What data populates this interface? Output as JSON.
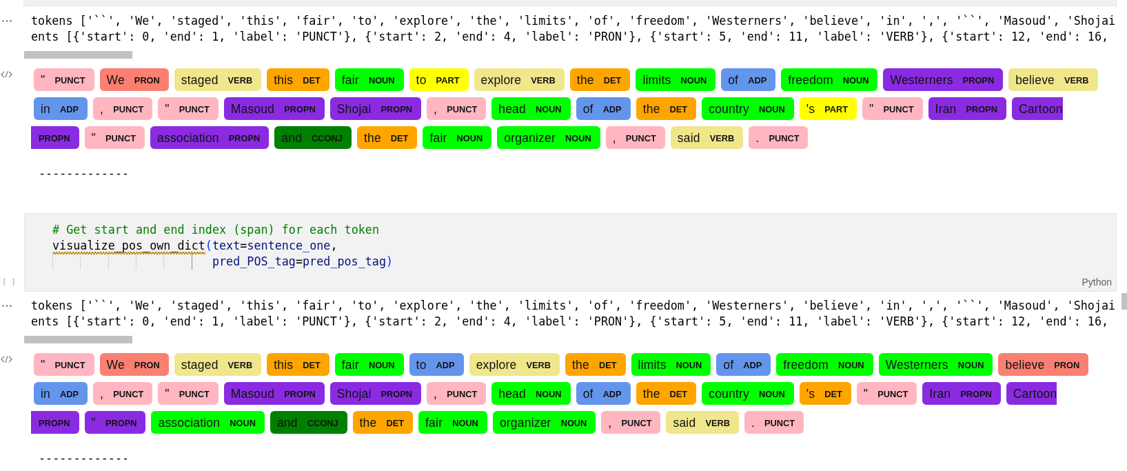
{
  "cells": [
    {
      "kind": "output",
      "text_lines": [
        "tokens ['``', 'We', 'staged', 'this', 'fair', 'to', 'explore', 'the', 'limits', 'of', 'freedom', 'Westerners', 'believe', 'in', ',', '``', 'Masoud', 'Shojai",
        "ents [{'start': 0, 'end': 1, 'label': 'PUNCT'}, {'start': 2, 'end': 4, 'label': 'PRON'}, {'start': 5, 'end': 11, 'label': 'VERB'}, {'start': 12, 'end': 16,"
      ],
      "entity_rows": [
        [
          {
            "kind": "whole",
            "text": "\"",
            "label": "PUNCT",
            "color": "#ffb6c1"
          },
          {
            "kind": "whole",
            "text": "We",
            "label": "PRON",
            "color": "#fa8072"
          },
          {
            "kind": "whole",
            "text": "staged",
            "label": "VERB",
            "color": "#f0e68c"
          },
          {
            "kind": "whole",
            "text": "this",
            "label": "DET",
            "color": "#ffa500"
          },
          {
            "kind": "whole",
            "text": "fair",
            "label": "NOUN",
            "color": "#00ff00"
          },
          {
            "kind": "whole",
            "text": "to",
            "label": "PART",
            "color": "#ffff00"
          },
          {
            "kind": "whole",
            "text": "explore",
            "label": "VERB",
            "color": "#f0e68c"
          },
          {
            "kind": "whole",
            "text": "the",
            "label": "DET",
            "color": "#ffa500"
          },
          {
            "kind": "whole",
            "text": "limits",
            "label": "NOUN",
            "color": "#00ff00"
          },
          {
            "kind": "whole",
            "text": "of",
            "label": "ADP",
            "color": "#6495ed"
          },
          {
            "kind": "whole",
            "text": "freedom",
            "label": "NOUN",
            "color": "#00ff00"
          },
          {
            "kind": "whole",
            "text": "Westerners",
            "label": "PROPN",
            "color": "#8a2be2"
          },
          {
            "kind": "whole",
            "text": "believe",
            "label": "VERB",
            "color": "#f0e68c"
          }
        ],
        [
          {
            "kind": "whole",
            "text": "in",
            "label": "ADP",
            "color": "#6495ed"
          },
          {
            "kind": "whole",
            "text": ",",
            "label": "PUNCT",
            "color": "#ffb6c1"
          },
          {
            "kind": "whole",
            "text": "\"",
            "label": "PUNCT",
            "color": "#ffb6c1"
          },
          {
            "kind": "whole",
            "text": "Masoud",
            "label": "PROPN",
            "color": "#8a2be2"
          },
          {
            "kind": "whole",
            "text": "Shojai",
            "label": "PROPN",
            "color": "#8a2be2"
          },
          {
            "kind": "whole",
            "text": ",",
            "label": "PUNCT",
            "color": "#ffb6c1"
          },
          {
            "kind": "whole",
            "text": "head",
            "label": "NOUN",
            "color": "#00ff00"
          },
          {
            "kind": "whole",
            "text": "of",
            "label": "ADP",
            "color": "#6495ed"
          },
          {
            "kind": "whole",
            "text": "the",
            "label": "DET",
            "color": "#ffa500"
          },
          {
            "kind": "whole",
            "text": "country",
            "label": "NOUN",
            "color": "#00ff00"
          },
          {
            "kind": "whole",
            "text": "'s",
            "label": "PART",
            "color": "#ffff00"
          },
          {
            "kind": "whole",
            "text": "\"",
            "label": "PUNCT",
            "color": "#ffb6c1"
          },
          {
            "kind": "whole",
            "text": "Iran",
            "label": "PROPN",
            "color": "#8a2be2"
          },
          {
            "kind": "head",
            "text": "Cartoon",
            "color": "#8a2be2"
          }
        ],
        [
          {
            "kind": "tail",
            "label": "PROPN",
            "color": "#8a2be2"
          },
          {
            "kind": "whole",
            "text": "\"",
            "label": "PUNCT",
            "color": "#ffb6c1"
          },
          {
            "kind": "whole",
            "text": "association",
            "label": "PROPN",
            "color": "#8a2be2"
          },
          {
            "kind": "whole",
            "text": "and",
            "label": "CCONJ",
            "color": "#008000"
          },
          {
            "kind": "whole",
            "text": "the",
            "label": "DET",
            "color": "#ffa500"
          },
          {
            "kind": "whole",
            "text": "fair",
            "label": "NOUN",
            "color": "#00ff00"
          },
          {
            "kind": "whole",
            "text": "organizer",
            "label": "NOUN",
            "color": "#00ff00"
          },
          {
            "kind": "whole",
            "text": ",",
            "label": "PUNCT",
            "color": "#ffb6c1"
          },
          {
            "kind": "whole",
            "text": "said",
            "label": "VERB",
            "color": "#f0e68c"
          },
          {
            "kind": "whole",
            "text": ".",
            "label": "PUNCT",
            "color": "#ffb6c1"
          }
        ]
      ],
      "separator": "-------------"
    },
    {
      "kind": "code",
      "prompt": "[ ]",
      "language": "Python",
      "lines": [
        {
          "continuation": false,
          "segments": [
            {
              "kind": "comment",
              "text": "# Get start and end index (span) for each token",
              "warning": false
            }
          ]
        },
        {
          "continuation": false,
          "segments": [
            {
              "kind": "function",
              "text": "visualize_pos_own_dict",
              "warning": true
            },
            {
              "kind": "bracket",
              "text": "(",
              "warning": false
            },
            {
              "kind": "param",
              "text": "text",
              "warning": false
            },
            {
              "kind": "operator",
              "text": "=",
              "warning": false
            },
            {
              "kind": "variable",
              "text": "sentence_one",
              "warning": false
            },
            {
              "kind": "punct",
              "text": ",",
              "warning": false
            }
          ]
        },
        {
          "continuation": true,
          "segments": [
            {
              "kind": "param",
              "text": "pred_POS_tag",
              "warning": false
            },
            {
              "kind": "operator",
              "text": "=",
              "warning": false
            },
            {
              "kind": "variable",
              "text": "pred_pos_tag",
              "warning": false
            },
            {
              "kind": "bracket",
              "text": ")",
              "warning": false
            }
          ]
        }
      ]
    },
    {
      "kind": "output",
      "text_lines": [
        "tokens ['``', 'We', 'staged', 'this', 'fair', 'to', 'explore', 'the', 'limits', 'of', 'freedom', 'Westerners', 'believe', 'in', ',', '``', 'Masoud', 'Shojai",
        "ents [{'start': 0, 'end': 1, 'label': 'PUNCT'}, {'start': 2, 'end': 4, 'label': 'PRON'}, {'start': 5, 'end': 11, 'label': 'VERB'}, {'start': 12, 'end': 16,"
      ],
      "entity_rows": [
        [
          {
            "kind": "whole",
            "text": "\"",
            "label": "PUNCT",
            "color": "#ffb6c1"
          },
          {
            "kind": "whole",
            "text": "We",
            "label": "PRON",
            "color": "#fa8072"
          },
          {
            "kind": "whole",
            "text": "staged",
            "label": "VERB",
            "color": "#f0e68c"
          },
          {
            "kind": "whole",
            "text": "this",
            "label": "DET",
            "color": "#ffa500"
          },
          {
            "kind": "whole",
            "text": "fair",
            "label": "NOUN",
            "color": "#00ff00"
          },
          {
            "kind": "whole",
            "text": "to",
            "label": "ADP",
            "color": "#6495ed"
          },
          {
            "kind": "whole",
            "text": "explore",
            "label": "VERB",
            "color": "#f0e68c"
          },
          {
            "kind": "whole",
            "text": "the",
            "label": "DET",
            "color": "#ffa500"
          },
          {
            "kind": "whole",
            "text": "limits",
            "label": "NOUN",
            "color": "#00ff00"
          },
          {
            "kind": "whole",
            "text": "of",
            "label": "ADP",
            "color": "#6495ed"
          },
          {
            "kind": "whole",
            "text": "freedom",
            "label": "NOUN",
            "color": "#00ff00"
          },
          {
            "kind": "whole",
            "text": "Westerners",
            "label": "NOUN",
            "color": "#00ff00"
          },
          {
            "kind": "whole",
            "text": "believe",
            "label": "PRON",
            "color": "#fa8072"
          }
        ],
        [
          {
            "kind": "whole",
            "text": "in",
            "label": "ADP",
            "color": "#6495ed"
          },
          {
            "kind": "whole",
            "text": ",",
            "label": "PUNCT",
            "color": "#ffb6c1"
          },
          {
            "kind": "whole",
            "text": "\"",
            "label": "PUNCT",
            "color": "#ffb6c1"
          },
          {
            "kind": "whole",
            "text": "Masoud",
            "label": "PROPN",
            "color": "#8a2be2"
          },
          {
            "kind": "whole",
            "text": "Shojai",
            "label": "PROPN",
            "color": "#8a2be2"
          },
          {
            "kind": "whole",
            "text": ",",
            "label": "PUNCT",
            "color": "#ffb6c1"
          },
          {
            "kind": "whole",
            "text": "head",
            "label": "NOUN",
            "color": "#00ff00"
          },
          {
            "kind": "whole",
            "text": "of",
            "label": "ADP",
            "color": "#6495ed"
          },
          {
            "kind": "whole",
            "text": "the",
            "label": "DET",
            "color": "#ffa500"
          },
          {
            "kind": "whole",
            "text": "country",
            "label": "NOUN",
            "color": "#00ff00"
          },
          {
            "kind": "whole",
            "text": "'s",
            "label": "DET",
            "color": "#ffa500"
          },
          {
            "kind": "whole",
            "text": "\"",
            "label": "PUNCT",
            "color": "#ffb6c1"
          },
          {
            "kind": "whole",
            "text": "Iran",
            "label": "PROPN",
            "color": "#8a2be2"
          },
          {
            "kind": "head",
            "text": "Cartoon",
            "color": "#8a2be2"
          }
        ],
        [
          {
            "kind": "tail",
            "label": "PROPN",
            "color": "#8a2be2"
          },
          {
            "kind": "whole",
            "text": "\"",
            "label": "PROPN",
            "color": "#8a2be2"
          },
          {
            "kind": "whole",
            "text": "association",
            "label": "NOUN",
            "color": "#00ff00"
          },
          {
            "kind": "whole",
            "text": "and",
            "label": "CCONJ",
            "color": "#008000"
          },
          {
            "kind": "whole",
            "text": "the",
            "label": "DET",
            "color": "#ffa500"
          },
          {
            "kind": "whole",
            "text": "fair",
            "label": "NOUN",
            "color": "#00ff00"
          },
          {
            "kind": "whole",
            "text": "organizer",
            "label": "NOUN",
            "color": "#00ff00"
          },
          {
            "kind": "whole",
            "text": ",",
            "label": "PUNCT",
            "color": "#ffb6c1"
          },
          {
            "kind": "whole",
            "text": "said",
            "label": "VERB",
            "color": "#f0e68c"
          },
          {
            "kind": "whole",
            "text": ".",
            "label": "PUNCT",
            "color": "#ffb6c1"
          }
        ]
      ],
      "separator": "-------------"
    }
  ]
}
